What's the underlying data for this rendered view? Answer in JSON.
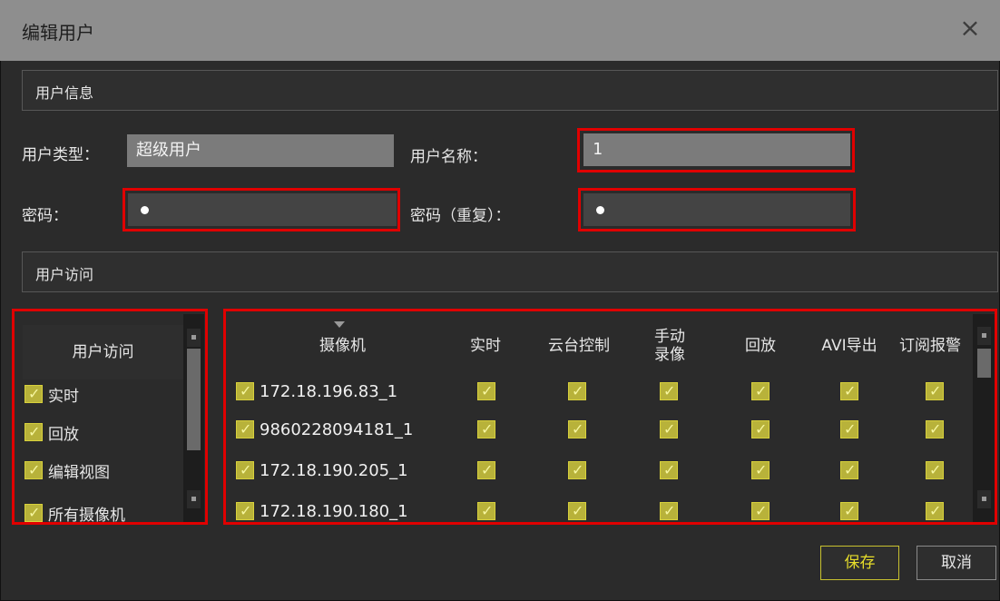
{
  "window": {
    "title": "编辑用户",
    "close_glyph": "×"
  },
  "user_info": {
    "section_title": "用户信息",
    "user_type_label": "用户类型：",
    "user_type_value": "超级用户",
    "user_name_label": "用户名称：",
    "user_name_value": "1",
    "password_label": "密码：",
    "password_repeat_label": "密码（重复）："
  },
  "user_access": {
    "section_title": "用户访问",
    "panel_header": "用户访问",
    "items": [
      {
        "label": "实时",
        "checked": true
      },
      {
        "label": "回放",
        "checked": true
      },
      {
        "label": "编辑视图",
        "checked": true
      },
      {
        "label": "所有摄像机",
        "checked": true
      }
    ]
  },
  "camera_table": {
    "columns": [
      "摄像机",
      "实时",
      "云台控制",
      "手动\n录像",
      "回放",
      "AVI导出",
      "订阅报警"
    ],
    "rows": [
      {
        "name": "172.18.196.83_1",
        "checked": [
          true,
          true,
          true,
          true,
          true,
          true,
          true
        ]
      },
      {
        "name": "9860228094181_1",
        "checked": [
          true,
          true,
          true,
          true,
          true,
          true,
          true
        ]
      },
      {
        "name": "172.18.190.205_1",
        "checked": [
          true,
          true,
          true,
          true,
          true,
          true,
          true
        ]
      },
      {
        "name": "172.18.190.180_1",
        "checked": [
          true,
          true,
          true,
          true,
          true,
          true,
          true
        ]
      }
    ]
  },
  "buttons": {
    "save": "保存",
    "cancel": "取消"
  },
  "colors": {
    "highlight_border": "#e00000",
    "checkbox": "#b8b23a",
    "save_accent": "#e6dd2a"
  }
}
